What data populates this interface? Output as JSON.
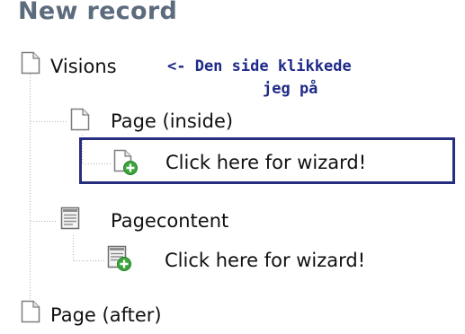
{
  "panel": {
    "title": "New record"
  },
  "tree": {
    "visions": {
      "label": "Visions",
      "icon": "page-icon"
    },
    "page_inside": {
      "label": "Page (inside)",
      "icon": "page-icon"
    },
    "wizard_page": {
      "label": "Click here for wizard!",
      "icon": "page-add-icon"
    },
    "pagecontent": {
      "label": "Pagecontent",
      "icon": "content-icon"
    },
    "wizard_content": {
      "label": "Click here for wizard!",
      "icon": "content-add-icon"
    },
    "page_after": {
      "label": "Page (after)",
      "icon": "page-icon"
    }
  },
  "annotation": {
    "line1": "<- Den side klikkede",
    "line2": "jeg på"
  },
  "colors": {
    "title": "#5c6b7d",
    "annotation": "#1f2a88",
    "highlight_border": "#262e80",
    "plus_badge": "#3aa63a"
  }
}
